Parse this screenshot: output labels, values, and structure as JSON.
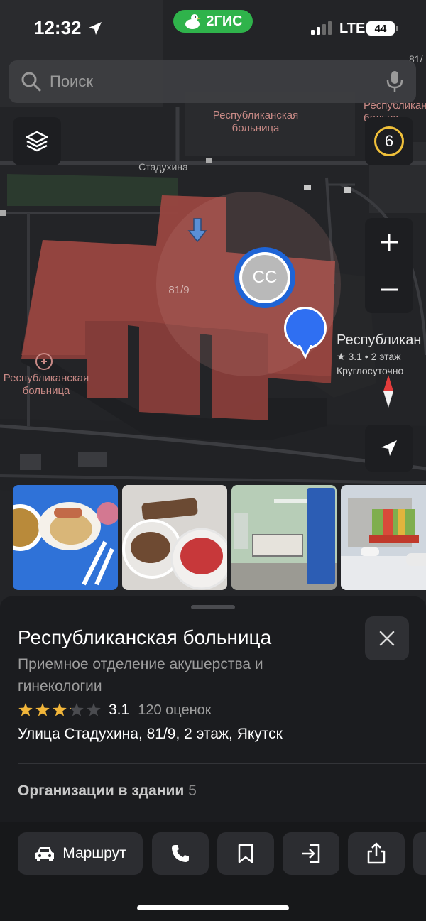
{
  "status_bar": {
    "time": "12:32",
    "brand": "2ГИС",
    "network": "LTE",
    "battery": "44",
    "signal_bars_filled": 2,
    "signal_bars_total": 4
  },
  "search": {
    "placeholder": "Поиск"
  },
  "map": {
    "traffic_level": "6",
    "labels": {
      "hospital_top": "Республиканская\nбольница",
      "hospital_top_right": "Республиканск\nбольни",
      "street": "Стадухина",
      "building_number": "81/9",
      "building_number_top_right": "81/",
      "hospital_left": "Республиканская\nбольница"
    },
    "avatar_initials": "CC",
    "poi": {
      "name": "Республикан",
      "meta": "★ 3.1 • 2 этаж",
      "hours": "Круглосуточно"
    },
    "colors": {
      "building": "#8c3f3b",
      "pin": "#2f6ff2",
      "brand": "#2fb34b",
      "traffic_ring": "#f0c03a"
    }
  },
  "photos": [
    {
      "subject": "hospital-meal-soup"
    },
    {
      "subject": "hospital-meal-bread"
    },
    {
      "subject": "hospital-ward"
    },
    {
      "subject": "hospital-building-exterior"
    }
  ],
  "place": {
    "title": "Республиканская больница",
    "subtitle": "Приемное отделение акушерства и гинекологии",
    "rating": "3.1",
    "rating_value": 3.1,
    "rating_count": "120 оценок",
    "address": "Улица Стадухина, 81/9, 2 этаж, Якутск",
    "orgs_label": "Организации в здании",
    "orgs_count": "5"
  },
  "actions": {
    "route": "Маршрут",
    "icons": [
      "phone-icon",
      "bookmark-icon",
      "login-icon",
      "share-icon"
    ]
  }
}
